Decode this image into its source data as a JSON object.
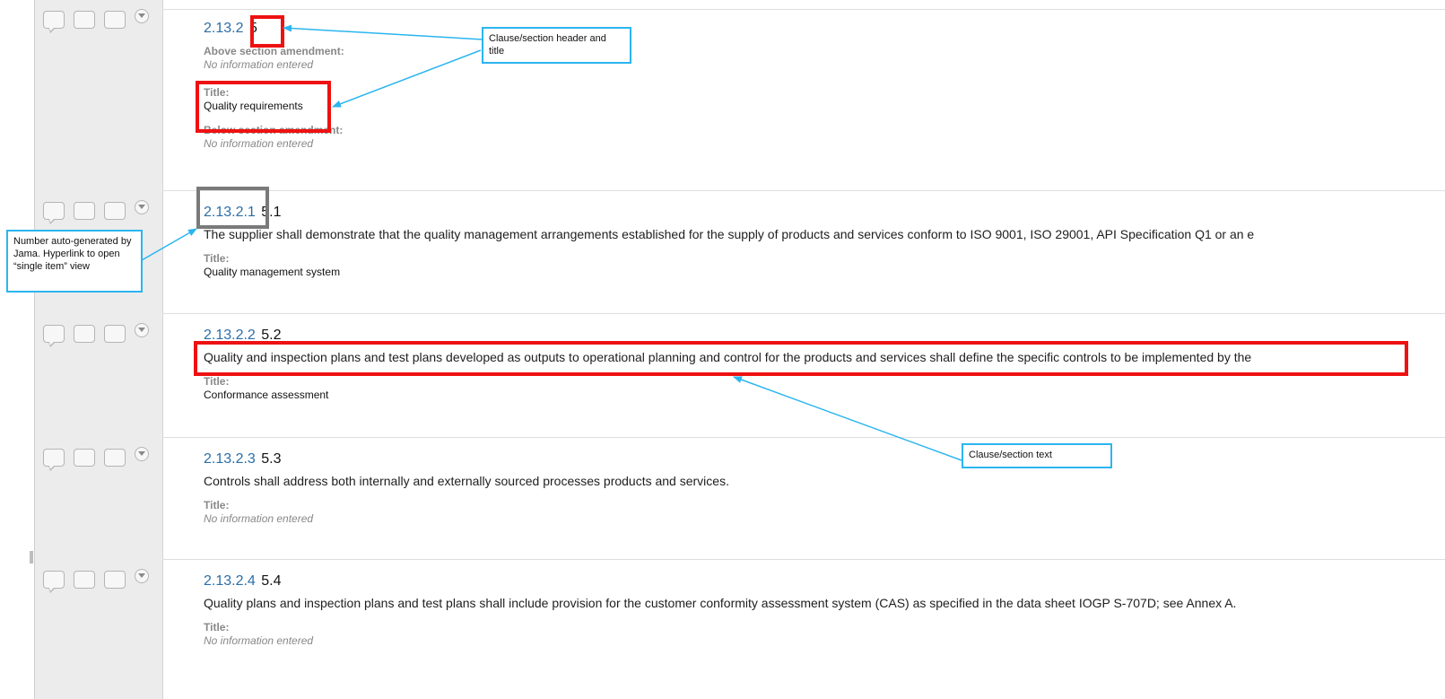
{
  "items": [
    {
      "number": "2.13.2",
      "header": "5",
      "fields": [
        {
          "label": "Above section amendment:",
          "value": "No information entered",
          "empty": true
        },
        {
          "label": "Title:",
          "value": "Quality requirements",
          "empty": false
        },
        {
          "label": "Below section amendment:",
          "value": "No information entered",
          "empty": true
        }
      ]
    },
    {
      "number": "2.13.2.1",
      "header": "5.1",
      "text": "The supplier shall demonstrate that the quality management arrangements established for the supply of products and services conform to ISO 9001, ISO 29001, API Specification Q1 or an e",
      "fields": [
        {
          "label": "Title:",
          "value": "Quality management system",
          "empty": false
        }
      ]
    },
    {
      "number": "2.13.2.2",
      "header": "5.2",
      "text": "Quality and inspection plans and test plans developed as outputs to operational planning and control for the products and services shall define the specific controls to be implemented by the",
      "fields": [
        {
          "label": "Title:",
          "value": "Conformance assessment",
          "empty": false
        }
      ]
    },
    {
      "number": "2.13.2.3",
      "header": "5.3",
      "text": "Controls shall address both internally and externally sourced processes products and services.",
      "fields": [
        {
          "label": "Title:",
          "value": "No information entered",
          "empty": true
        }
      ]
    },
    {
      "number": "2.13.2.4",
      "header": "5.4",
      "text": "Quality plans and inspection plans and test plans shall include provision for the customer conformity assessment system (CAS) as specified in the data sheet IOGP S-707D; see Annex A.",
      "fields": [
        {
          "label": "Title:",
          "value": "No information entered",
          "empty": true
        }
      ]
    }
  ],
  "callouts": {
    "header_title": "Clause/section header and title",
    "auto_number": "Number auto-generated by Jama. Hyperlink to open “single item” view",
    "section_text": "Clause/section text"
  },
  "colors": {
    "link": "#2c6ea8",
    "highlight_red": "#ee1111",
    "highlight_grey": "#7a7a7a",
    "callout_blue": "#2bb5ef"
  },
  "icons": [
    "comment-icon",
    "box-icon",
    "box-icon",
    "dropdown-menu-icon"
  ]
}
